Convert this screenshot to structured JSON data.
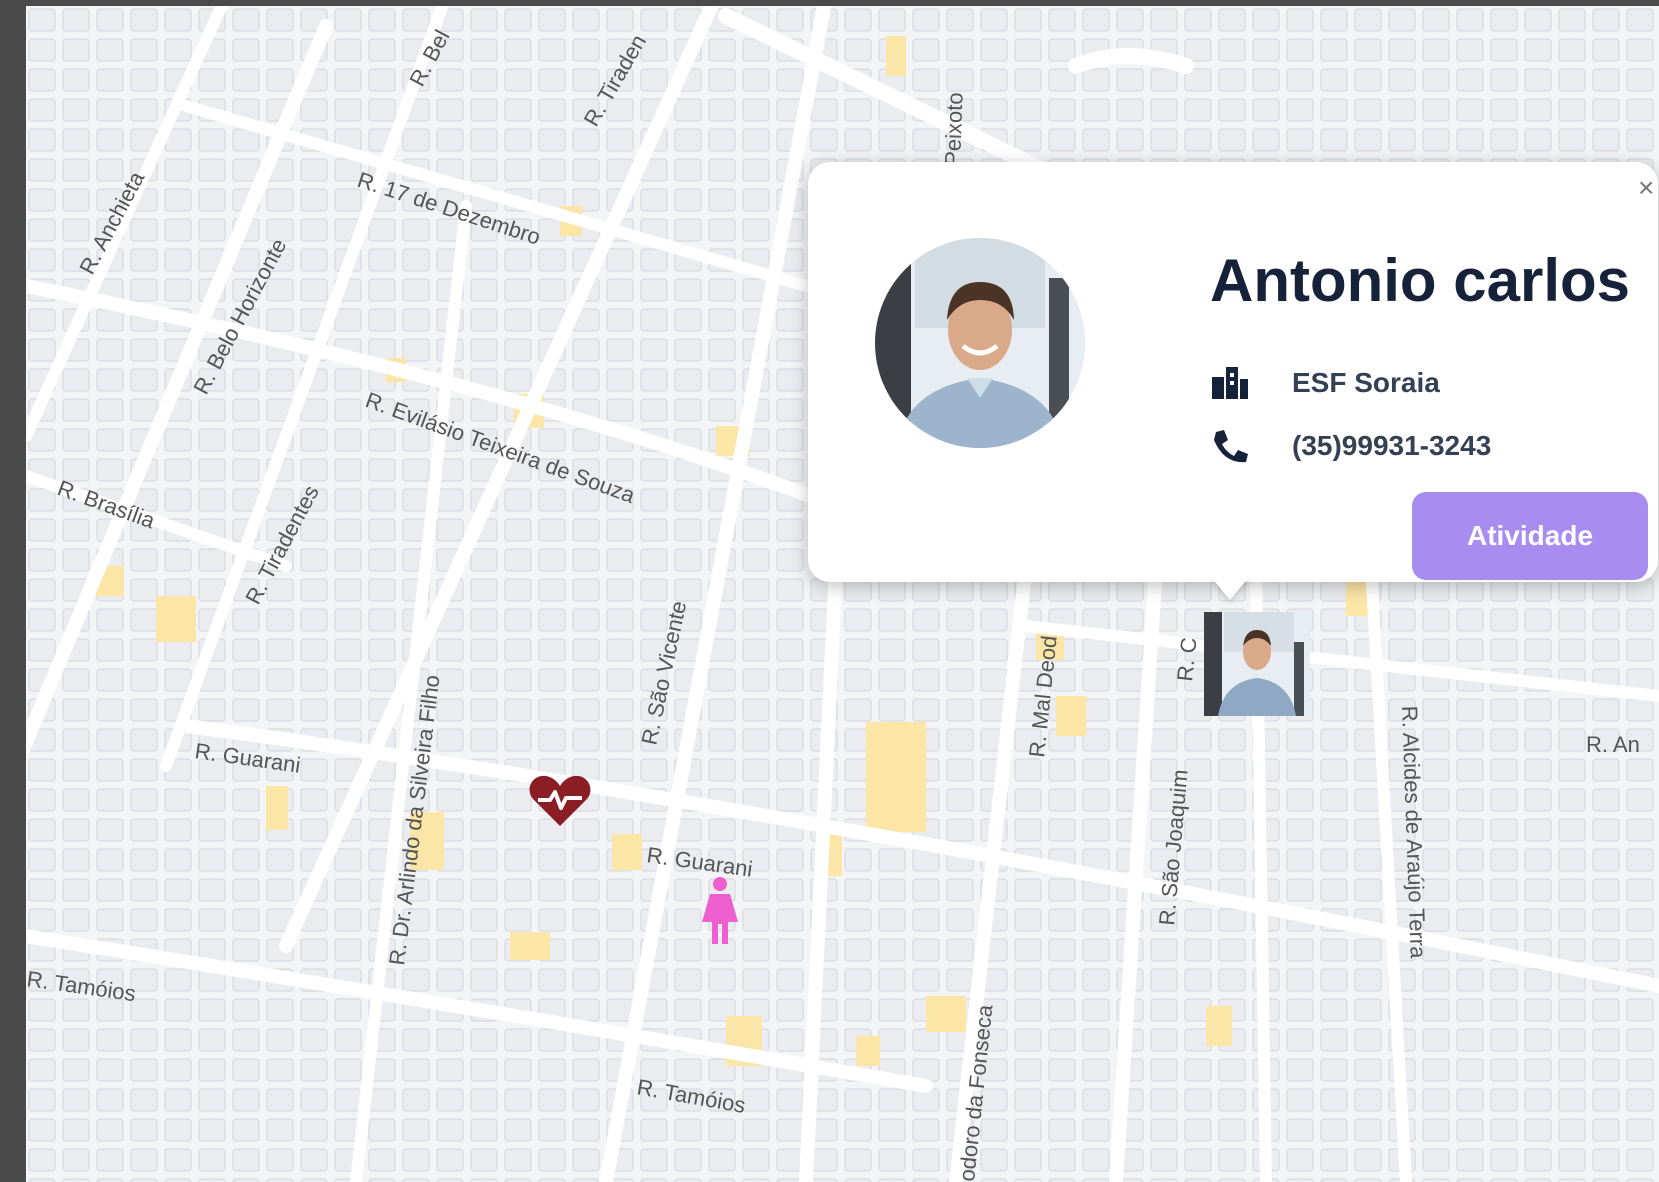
{
  "map": {
    "streets": [
      "R. Anchieta",
      "R. Belo Horizonte",
      "R. 17 de Dezembro",
      "R. Evilásio Teixeira de Souza",
      "R. Brasília",
      "R. Tiradentes",
      "R. Dr. Arlindo da Silveira Filho",
      "R. São Vicente",
      "R. Guarani",
      "R. Guarani",
      "R. Tamóios",
      "R. Tamóios",
      "R. Mal Deod",
      "odoro da Fonseca",
      "R. São Joaquim",
      "R. Alcides de Araújo Terra",
      "R. An",
      "Peixoto",
      "R. Tiraden",
      "R. Bel",
      "R. C"
    ]
  },
  "popup": {
    "name": "Antonio carlos",
    "unit": "ESF Soraia",
    "phone": "(35)99931-3243",
    "button_label": "Atividade",
    "close_label": "×"
  },
  "colors": {
    "accent": "#a98cf0",
    "heart": "#8b1e24",
    "pink_marker": "#ee5fcf"
  },
  "icons": {
    "unit": "building-icon",
    "phone": "phone-icon",
    "heart_marker": "heart-pulse-icon",
    "pink_marker": "female-person-icon"
  }
}
